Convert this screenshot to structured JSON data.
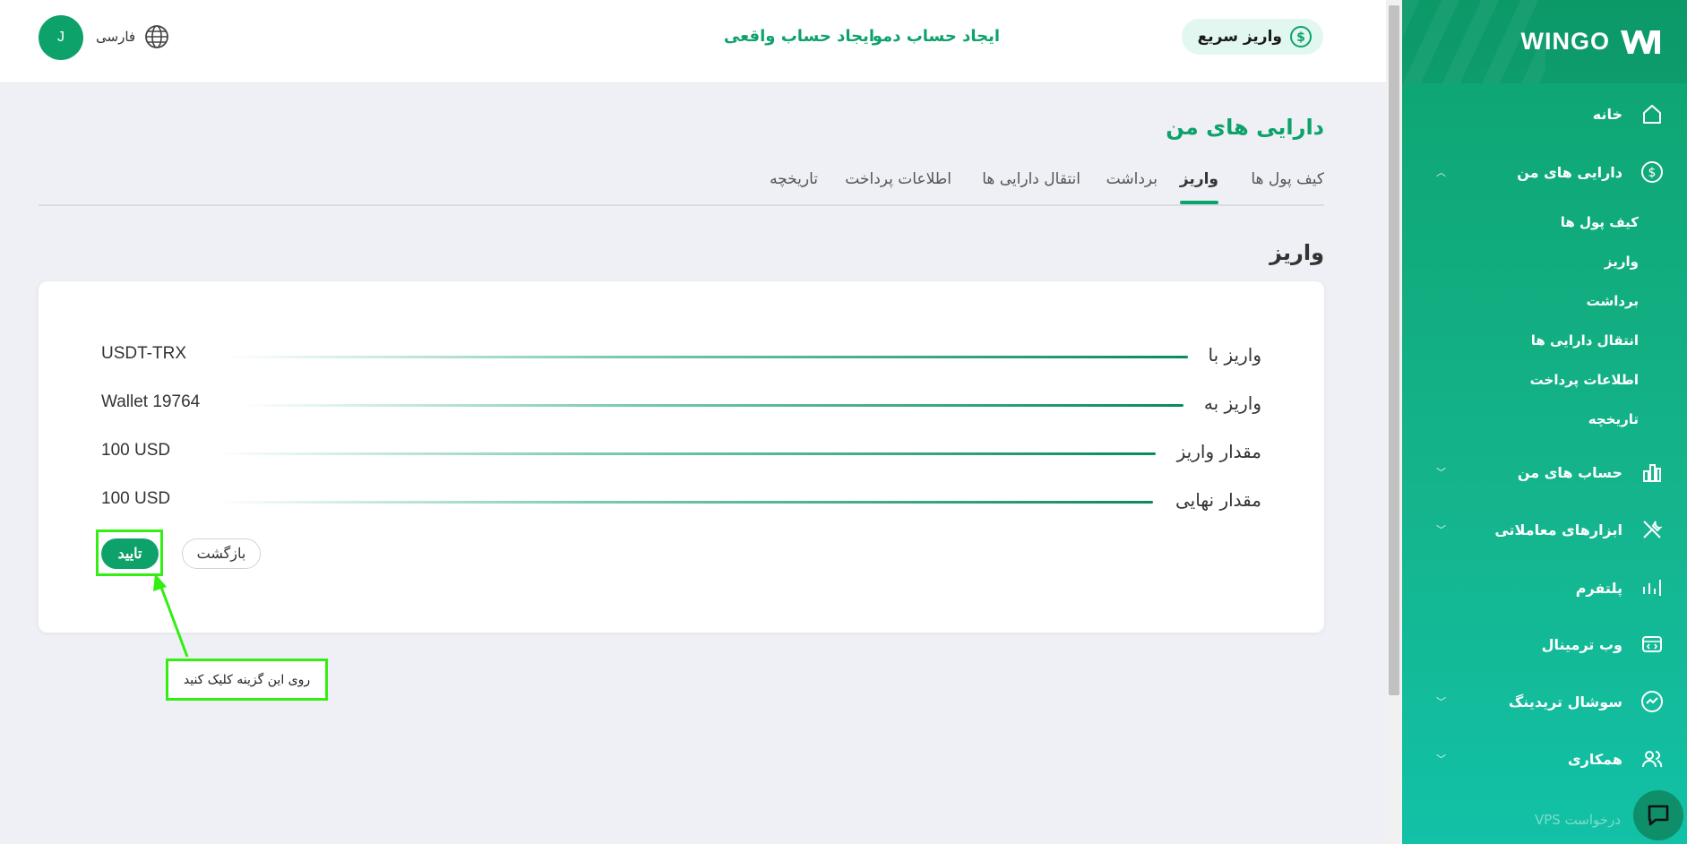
{
  "brand": {
    "name": "WINGO"
  },
  "colors": {
    "accent": "#0ea26b",
    "sidebar_top": "#0da36f",
    "sidebar_bottom": "#12c1a6",
    "highlight": "#33ee11"
  },
  "sidebar": {
    "items": [
      {
        "label": "خانه",
        "icon": "home-icon"
      },
      {
        "label": "دارایی های من",
        "icon": "dollar-circle-icon",
        "expanded": true
      },
      {
        "label": "حساب های من",
        "icon": "bar-chart-icon"
      },
      {
        "label": "ابزارهای معاملاتی",
        "icon": "tools-icon"
      },
      {
        "label": "پلتفرم",
        "icon": "platform-icon"
      },
      {
        "label": "وب ترمینال",
        "icon": "code-window-icon"
      },
      {
        "label": "سوشال تریدینگ",
        "icon": "trend-circle-icon"
      },
      {
        "label": "همکاری",
        "icon": "users-icon"
      }
    ],
    "sub_items": [
      "کیف پول ها",
      "واریز",
      "برداشت",
      "انتقال دارایی ها",
      "اطلاعات پرداخت",
      "تاریخچه"
    ],
    "vps": "درخواست VPS"
  },
  "header": {
    "quick_deposit": "واریز سریع",
    "real_account": "ایجاد حساب واقعی",
    "demo_account": "ایجاد حساب دمو",
    "language": "فارسی",
    "avatar_initial": "J"
  },
  "main": {
    "title": "دارایی های من",
    "tabs": [
      "کیف پول ها",
      "واریز",
      "برداشت",
      "انتقال دارایی ها",
      "اطلاعات پرداخت",
      "تاریخچه"
    ],
    "active_tab": "واریز",
    "section_title": "واریز",
    "rows": [
      {
        "label": "واریز با",
        "value": "USDT-TRX"
      },
      {
        "label": "واریز به",
        "value": "Wallet 19764"
      },
      {
        "label": "مقدار واریز",
        "value": "100 USD"
      },
      {
        "label": "مقدار نهایی",
        "value": "100 USD"
      }
    ],
    "confirm_button": "تایید",
    "back_button": "بازگشت"
  },
  "annotation": {
    "tip": "روی این گزینه کلیک کنید"
  }
}
